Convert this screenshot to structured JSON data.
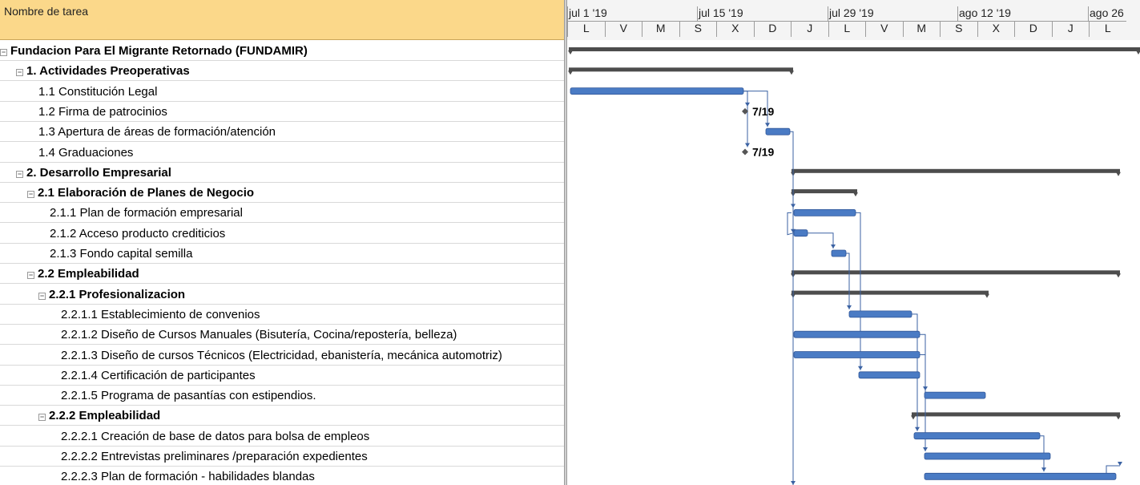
{
  "table": {
    "header": "Nombre de tarea",
    "rows": [
      {
        "label": "Fundacion Para El Migrante Retornado (FUNDAMIR)",
        "level": 0,
        "summary": true
      },
      {
        "label": "1. Actividades Preoperativas",
        "level": 1,
        "summary": true
      },
      {
        "label": "1.1 Constitución Legal",
        "level": 2,
        "summary": false
      },
      {
        "label": "1.2 Firma de patrocinios",
        "level": 2,
        "summary": false
      },
      {
        "label": "1.3 Apertura de áreas de formación/atención",
        "level": 2,
        "summary": false
      },
      {
        "label": "1.4 Graduaciones",
        "level": 2,
        "summary": false
      },
      {
        "label": "2. Desarrollo Empresarial",
        "level": 1,
        "summary": true
      },
      {
        "label": "2.1 Elaboración de Planes de Negocio",
        "level": 2,
        "summary": true
      },
      {
        "label": "2.1.1 Plan de formación empresarial",
        "level": 3,
        "summary": false
      },
      {
        "label": "2.1.2 Acceso producto crediticios",
        "level": 3,
        "summary": false
      },
      {
        "label": "2.1.3 Fondo capital semilla",
        "level": 3,
        "summary": false
      },
      {
        "label": "2.2 Empleabilidad",
        "level": 2,
        "summary": true
      },
      {
        "label": "2.2.1 Profesionalizacion",
        "level": 3,
        "summary": true
      },
      {
        "label": "2.2.1.1 Establecimiento de convenios",
        "level": 4,
        "summary": false
      },
      {
        "label": "2.2.1.2 Diseño de Cursos Manuales (Bisutería, Cocina/repostería, belleza)",
        "level": 4,
        "summary": false
      },
      {
        "label": "2.2.1.3 Diseño de cursos Técnicos (Electricidad, ebanistería, mecánica automotriz)",
        "level": 4,
        "summary": false
      },
      {
        "label": "2.2.1.4 Certificación de participantes",
        "level": 4,
        "summary": false
      },
      {
        "label": "2.2.1.5 Programa de pasantías con estipendios.",
        "level": 4,
        "summary": false
      },
      {
        "label": "2.2.2 Empleabilidad",
        "level": 3,
        "summary": true
      },
      {
        "label": "2.2.2.1 Creación de base de datos para bolsa de empleos",
        "level": 4,
        "summary": false
      },
      {
        "label": "2.2.2.2 Entrevistas preliminares /preparación expedientes",
        "level": 4,
        "summary": false
      },
      {
        "label": "2.2.2.3 Plan de formación - habilidades blandas",
        "level": 4,
        "summary": false
      }
    ]
  },
  "gantt": {
    "major_scale": [
      "jul 1 '19",
      "jul 15 '19",
      "jul 29 '19",
      "ago 12 '19",
      "ago 26"
    ],
    "minor_scale": [
      "L",
      "V",
      "M",
      "S",
      "X",
      "D",
      "J",
      "L",
      "V",
      "M",
      "S",
      "X",
      "D",
      "J",
      "L"
    ],
    "milestone_labels": [
      "7/19",
      "7/19"
    ],
    "colors": {
      "task_bar": "#4a7bc4",
      "summary_bar": "#4d4d4d",
      "link": "#3b62a3",
      "header_bg": "#fbd88a"
    }
  }
}
